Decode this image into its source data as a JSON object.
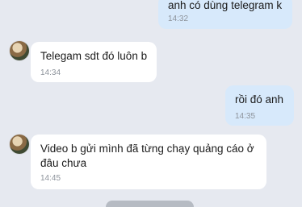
{
  "messages": [
    {
      "direction": "out",
      "text": "anh có dùng telegram k",
      "time": "14:32"
    },
    {
      "direction": "in",
      "text": "Telegam sdt đó luôn b",
      "time": "14:34"
    },
    {
      "direction": "out",
      "text": "rồi đó anh",
      "time": "14:35"
    },
    {
      "direction": "in",
      "text_line1": "Video b gửi mình đã từng chạy quảng cáo ở",
      "text_line2": "đâu chưa",
      "time": "14:45"
    }
  ]
}
